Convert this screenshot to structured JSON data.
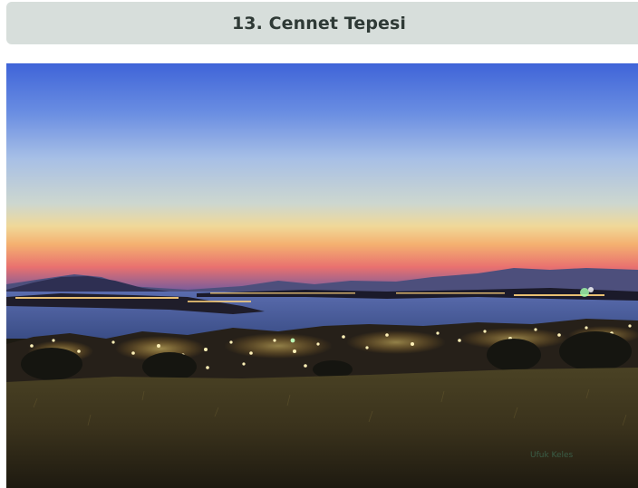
{
  "section": {
    "title": "13. Cennet Tepesi"
  },
  "photo": {
    "watermark": "Ufuk Keles"
  }
}
